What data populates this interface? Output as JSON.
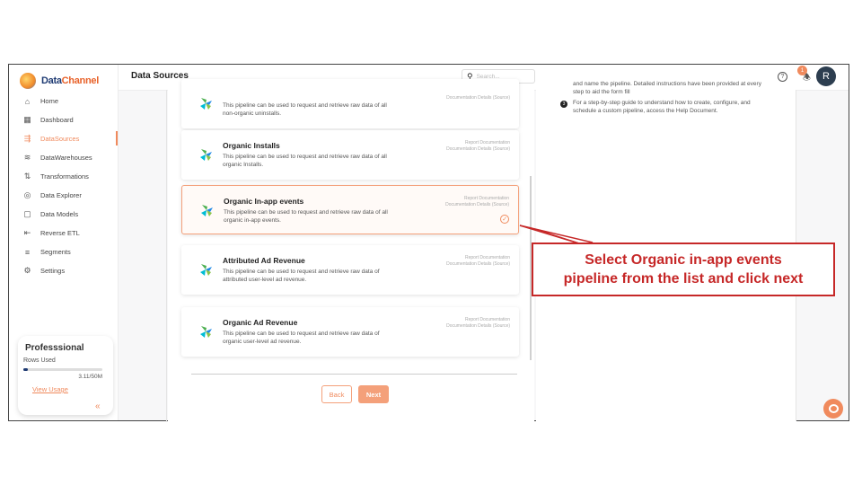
{
  "brand": {
    "name_part1": "Data",
    "name_part2": "Channel"
  },
  "sidebar": {
    "items": [
      {
        "label": "Home",
        "icon": "home-icon",
        "glyph": "⌂",
        "active": false
      },
      {
        "label": "Dashboard",
        "icon": "dashboard-icon",
        "glyph": "▦",
        "active": false
      },
      {
        "label": "DataSources",
        "icon": "datasources-icon",
        "glyph": "⇶",
        "active": true
      },
      {
        "label": "DataWarehouses",
        "icon": "warehouse-icon",
        "glyph": "≋",
        "active": false
      },
      {
        "label": "Transformations",
        "icon": "transform-icon",
        "glyph": "⇅",
        "active": false
      },
      {
        "label": "Data Explorer",
        "icon": "explorer-icon",
        "glyph": "◎",
        "active": false
      },
      {
        "label": "Data Models",
        "icon": "models-icon",
        "glyph": "▢",
        "active": false
      },
      {
        "label": "Reverse ETL",
        "icon": "reverse-etl-icon",
        "glyph": "⇤",
        "active": false
      },
      {
        "label": "Segments",
        "icon": "segments-icon",
        "glyph": "≡",
        "active": false
      },
      {
        "label": "Settings",
        "icon": "settings-icon",
        "glyph": "⚙",
        "active": false
      }
    ],
    "plan": {
      "name": "Professsional",
      "rows_label": "Rows Used",
      "usage_fraction": 0.06,
      "rows_count": "3.11/50M",
      "link": "View Usage"
    },
    "collapse_glyph": "«"
  },
  "topbar": {
    "title": "Data Sources",
    "search_placeholder": "Search...",
    "help_glyph": "?",
    "notification_count": "1",
    "avatar_initial": "R"
  },
  "pipelines": [
    {
      "title": "",
      "desc": "This pipeline can be used to request and retrieve raw data of all non-organic uninstalls.",
      "meta1": "",
      "meta2": "Documentation Details (Source)",
      "selected": false
    },
    {
      "title": "Organic Installs",
      "desc": "This pipeline can be used to request and retrieve raw data of all organic Installs.",
      "meta1": "Report Documentation",
      "meta2": "Documentation Details (Source)",
      "selected": false
    },
    {
      "title": "Organic In-app events",
      "desc": "This pipeline can be used to request and retrieve raw data of all organic in-app events.",
      "meta1": "Report Documentation",
      "meta2": "Documentation Details (Source)",
      "selected": true
    },
    {
      "title": "Attributed Ad Revenue",
      "desc": "This pipeline can be used to request and retrieve raw data of attributed user-level ad revenue.",
      "meta1": "Report Documentation",
      "meta2": "Documentation Details (Source)",
      "selected": false
    },
    {
      "title": "Organic Ad Revenue",
      "desc": "This pipeline can be used to request and retrieve raw data of organic user-level ad revenue.",
      "meta1": "Report Documentation",
      "meta2": "Documentation Details (Source)",
      "selected": false
    }
  ],
  "actions": {
    "back": "Back",
    "next": "Next"
  },
  "help_panel": {
    "text1": "and name the pipeline. Detailed instructions have been provided at every step to aid the form fill",
    "step_number": "3",
    "text2": "For a step-by-step guide to understand how to create, configure, and schedule a custom pipeline, access the Help Document."
  },
  "callout": {
    "line1": "Select Organic in-app events",
    "line2": "pipeline from the list and click next",
    "color": "#c62828"
  },
  "colors": {
    "accent": "#f08a5d",
    "brand_blue": "#1f3b73"
  }
}
